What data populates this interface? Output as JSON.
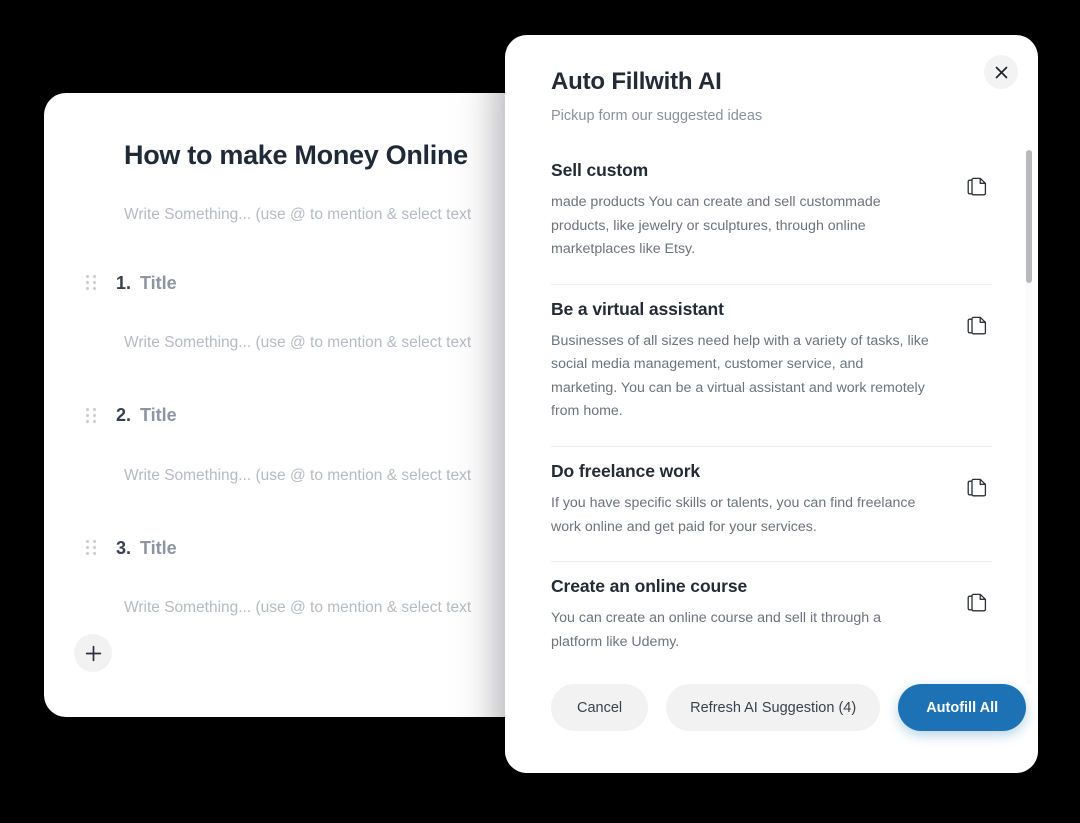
{
  "document_card": {
    "title": "How to make Money Online",
    "placeholder": "Write Something... (use @ to mention & select text",
    "add_block_icon": "plus-icon",
    "list_items": [
      {
        "number": "1.",
        "label": "Title",
        "placeholder": "Write Something... (use @ to mention & select text"
      },
      {
        "number": "2.",
        "label": "Title",
        "placeholder": "Write Something... (use @ to mention & select text"
      },
      {
        "number": "3.",
        "label": "Title",
        "placeholder": "Write Something... (use @ to mention & select text"
      }
    ]
  },
  "modal": {
    "title": "Auto Fillwith AI",
    "subtitle": "Pickup form our suggested ideas",
    "close_icon": "close-icon",
    "copy_icon": "copy-icon",
    "suggestions": [
      {
        "title": "Sell custom",
        "body": "made products You can create and sell custommade products, like jewelry or sculptures, through online marketplaces like Etsy."
      },
      {
        "title": "Be a virtual assistant",
        "body": "Businesses of all sizes need help with a variety of tasks, like social media management, customer service, and marketing. You can be a virtual assistant and work remotely from home."
      },
      {
        "title": "Do freelance work",
        "body": "If you have specific skills or talents, you can find freelance work online and get paid for your services."
      },
      {
        "title": "Create an online course",
        "body": "You can create an online course and sell it through a platform like Udemy."
      }
    ],
    "footer": {
      "cancel_label": "Cancel",
      "refresh_label": "Refresh AI Suggestion (4)",
      "autofill_label": "Autofill All",
      "primary_color": "#1c72b5"
    }
  }
}
